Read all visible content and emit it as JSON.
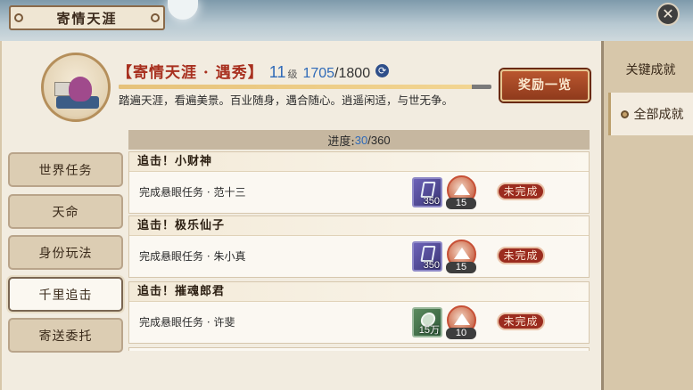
{
  "window": {
    "title": "寄情天涯",
    "close_glyph": "✕"
  },
  "achievement": {
    "name": "【寄情天涯 · 遇秀】",
    "level": "11",
    "level_unit": "级",
    "exp_current": "1705",
    "exp_max": "/1800",
    "exp_fraction": 0.947,
    "description": "踏遍天涯，看遍美景。百业随身，遇合随心。逍遥闲适，与世无争。",
    "reward_button": "奖励一览"
  },
  "right_tabs": [
    {
      "label": "关键成就",
      "active": false
    },
    {
      "label": "全部成就",
      "active": true
    }
  ],
  "left_tabs": [
    {
      "label": "世界任务",
      "active": false
    },
    {
      "label": "天命",
      "active": false
    },
    {
      "label": "身份玩法",
      "active": false
    },
    {
      "label": "千里追击",
      "active": true
    },
    {
      "label": "寄送委托",
      "active": false
    }
  ],
  "progress": {
    "label": "进度:",
    "current": "30",
    "separator": "/",
    "total": "360"
  },
  "tasks": [
    {
      "title": "追击！小财神",
      "desc": "完成悬眼任务 · 范十三",
      "item_icon": "book-icon",
      "item_qty": "350",
      "token_icon": "mountain-coin-icon",
      "token_qty": "15",
      "status": "未完成"
    },
    {
      "title": "追击！极乐仙子",
      "desc": "完成悬眼任务 · 朱小真",
      "item_icon": "book-icon",
      "item_qty": "350",
      "token_icon": "mountain-coin-icon",
      "token_qty": "15",
      "status": "未完成"
    },
    {
      "title": "追击！摧魂郎君",
      "desc": "完成悬眼任务 · 许斐",
      "item_icon": "silver-coin-icon",
      "item_qty": "15万",
      "token_icon": "mountain-coin-icon",
      "token_qty": "10",
      "status": "未完成"
    }
  ],
  "colors": {
    "accent_red": "#a8301f",
    "level_blue": "#2f6ab8",
    "status_red": "#9b2c1f",
    "reward_button": "#b9562f"
  }
}
